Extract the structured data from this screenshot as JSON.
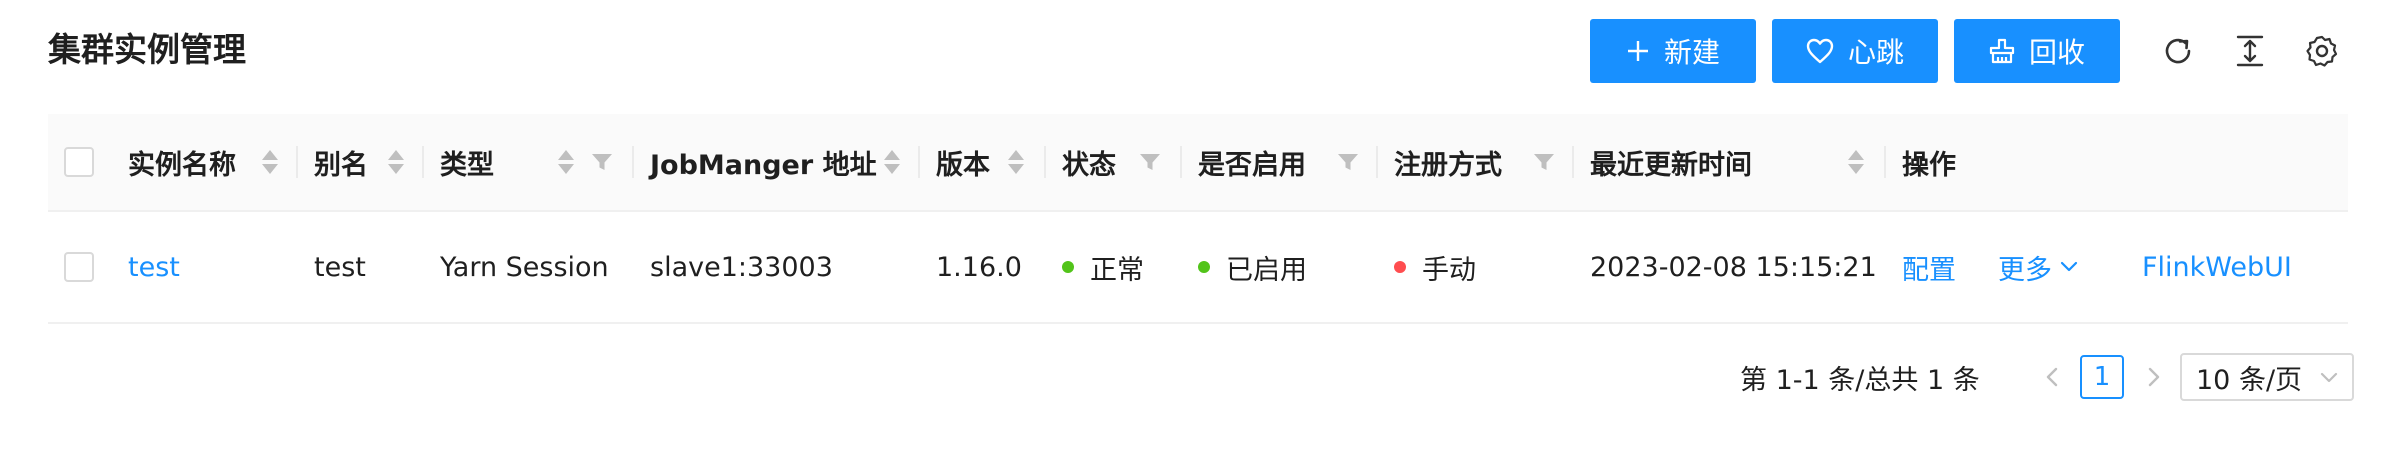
{
  "page": {
    "title": "集群实例管理"
  },
  "toolbar": {
    "new_label": "新建",
    "heartbeat_label": "心跳",
    "recycle_label": "回收"
  },
  "table": {
    "headers": {
      "name": "实例名称",
      "alias": "别名",
      "type": "类型",
      "address": "JobManger 地址",
      "version": "版本",
      "status": "状态",
      "enabled": "是否启用",
      "register": "注册方式",
      "updated": "最近更新时间",
      "actions": "操作"
    },
    "rows": [
      {
        "name": "test",
        "alias": "test",
        "type": "Yarn Session",
        "address": "slave1:33003",
        "version": "1.16.0",
        "status": "正常",
        "enabled": "已启用",
        "register": "手动",
        "updated": "2023-02-08 15:15:21",
        "actions": {
          "config": "配置",
          "more": "更多",
          "webui": "FlinkWebUI"
        }
      }
    ]
  },
  "pagination": {
    "total_text": "第 1-1 条/总共 1 条",
    "current_page": "1",
    "page_size": "10 条/页"
  },
  "colors": {
    "primary": "#1890ff",
    "success": "#52c41a",
    "error": "#ff4d4f"
  }
}
